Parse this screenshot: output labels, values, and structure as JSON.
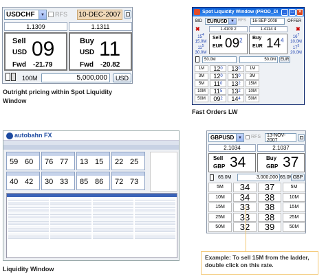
{
  "panel1": {
    "pair": "USDCHF",
    "rfs": "RFS",
    "date": "10-DEC-2007",
    "bid_rate": "1.1309",
    "ask_rate": "1.1311",
    "sell_label": "Sell",
    "buy_label": "Buy",
    "sell_ccy": "USD",
    "buy_ccy": "USD",
    "sell_big": "09",
    "buy_big": "11",
    "fwd_label": "Fwd",
    "sell_fwd": "-21.79",
    "buy_fwd": "-20.82",
    "qty_label": "100M",
    "amount": "5,000,000",
    "ccy_button": "USD",
    "caption": "Outright pricing within Spot Liquidity Window"
  },
  "panel2": {
    "title": "Spot Liquidity Window (PROD_DEMO ...",
    "bid_label": "BID",
    "pair": "EURUSD",
    "rfs": "RFS",
    "date": "16-SEP-2008",
    "offer_label": "OFFER",
    "bid_rate": "1.4109 2",
    "ask_rate": "1.4114 4",
    "left_side_top": "15",
    "left_side_top_sup": "4",
    "left_side_top_qty": "15.0M",
    "left_side_bottom": "11",
    "left_side_bottom_sup": "5",
    "left_side_bottom_qty": "30.0M",
    "right_side_top": "16",
    "right_side_top_sup": "7",
    "right_side_top_qty": "10.0M",
    "right_side_bottom": "17",
    "right_side_bottom_sup": "5",
    "right_side_bottom_qty": "20.0M",
    "sell_label": "Sell",
    "buy_label": "Buy",
    "sell_ccy": "EUR",
    "buy_ccy": "EUR",
    "sell_big": "09",
    "sell_sup": "2",
    "buy_big": "14",
    "buy_sup": "4",
    "qty_value": "50.0M",
    "qty_value2": "50.0M",
    "ccy_button": "EUR",
    "ladder": [
      {
        "qty": "1M",
        "bid": "12",
        "bid_sup": "0",
        "ask": "13",
        "ask_sup": "0"
      },
      {
        "qty": "3M",
        "bid": "12",
        "bid_sup": "0",
        "ask": "13",
        "ask_sup": "0"
      },
      {
        "qty": "5M",
        "bid": "11",
        "bid_sup": "0",
        "ask": "13",
        "ask_sup": "2"
      },
      {
        "qty": "10M",
        "bid": "11",
        "bid_sup": "5",
        "ask": "13",
        "ask_sup": "2"
      },
      {
        "qty": "50M",
        "bid": "09",
        "bid_sup": "2",
        "ask": "14",
        "ask_sup": "4"
      }
    ],
    "right_qty": [
      "1M",
      "3M",
      "15M",
      "10M",
      "50M"
    ],
    "caption": "Fast Orders LW"
  },
  "panel3": {
    "logo": "autobahn FX",
    "caption": "Liquidity Window",
    "tiles": [
      {
        "l": "59",
        "r": "60"
      },
      {
        "l": "76",
        "r": "77"
      },
      {
        "l": "13",
        "r": "15"
      },
      {
        "l": "22",
        "r": "25"
      },
      {
        "l": "40",
        "r": "42"
      },
      {
        "l": "30",
        "r": "33"
      },
      {
        "l": "85",
        "r": "86"
      },
      {
        "l": "72",
        "r": "73"
      }
    ]
  },
  "panel4": {
    "pair": "GBPUSD",
    "rfs": "RFS",
    "date": "13-NOV-2007",
    "bid_rate": "2.1034",
    "ask_rate": "2.1037",
    "sell_label": "Sell",
    "buy_label": "Buy",
    "sell_ccy": "GBP",
    "buy_ccy": "GBP",
    "sell_big": "34",
    "buy_big": "37",
    "qty_value": "65.0M",
    "amount": "3,000,000",
    "qty_value2": "65.0M",
    "ccy_button": "GBP",
    "ladder": [
      {
        "qty": "5M",
        "bid": "34",
        "ask": "37",
        "qty2": "5M"
      },
      {
        "qty": "10M",
        "bid": "34",
        "ask": "38",
        "qty2": "10M"
      },
      {
        "qty": "15M",
        "bid": "33",
        "ask": "38",
        "qty2": "15M"
      },
      {
        "qty": "25M",
        "bid": "33",
        "ask": "38",
        "qty2": "25M"
      },
      {
        "qty": "50M",
        "bid": "32",
        "ask": "39",
        "qty2": "50M"
      }
    ],
    "callout": "Example: To sell 15M from the ladder, double click on this rate.",
    "callout_color": "#f3c772"
  }
}
